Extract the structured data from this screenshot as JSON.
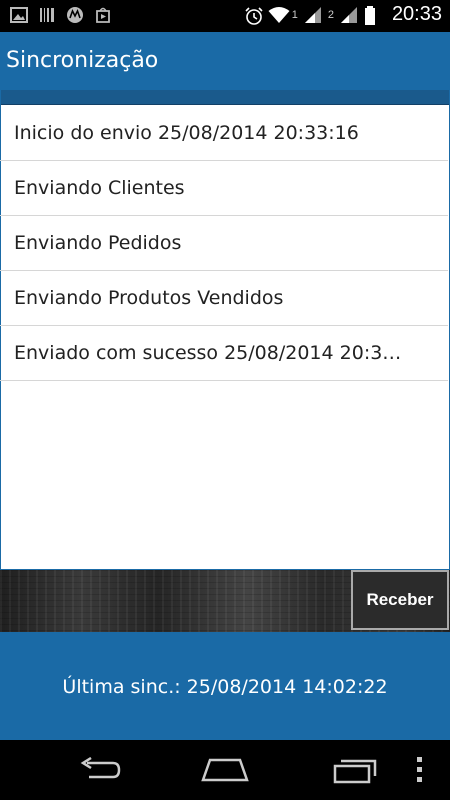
{
  "status_bar": {
    "time": "20:33",
    "sim1_label": "1",
    "sim2_label": "2",
    "icons": [
      "image-icon",
      "barcode-icon",
      "motorola-icon",
      "play-store-icon",
      "alarm-icon",
      "wifi-icon",
      "signal-icon",
      "battery-icon"
    ]
  },
  "action_bar": {
    "title": "Sincronização"
  },
  "log": {
    "items": [
      "Inicio do envio 25/08/2014 20:33:16",
      "Enviando Clientes",
      "Enviando Pedidos",
      "Enviando Produtos Vendidos",
      "Enviado com sucesso 25/08/2014 20:3…"
    ]
  },
  "actions": {
    "receive_label": "Receber"
  },
  "footer": {
    "last_sync": "Última sinc.: 25/08/2014 14:02:22"
  },
  "colors": {
    "accent": "#1a6aa6",
    "wood": "#2e2e2e"
  }
}
